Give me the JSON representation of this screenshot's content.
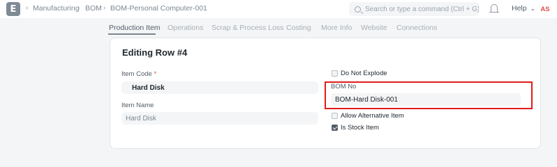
{
  "navbar": {
    "logo_letter": "E",
    "breadcrumbs": [
      "Manufacturing",
      "BOM",
      "BOM-Personal Computer-001"
    ],
    "search_placeholder": "Search or type a command (Ctrl + G)",
    "help_label": "Help",
    "help_chevron": "⌄",
    "avatar_initials": "AS",
    "breadcrumb_separator": "›"
  },
  "tabs": [
    "Production Item",
    "Operations",
    "Scrap & Process Loss",
    "Costing",
    "More Info",
    "Website",
    "Connections"
  ],
  "active_tab": "Production Item",
  "card": {
    "title": "Editing Row #4",
    "item_code": {
      "label": "Item Code",
      "required_mark": "*",
      "value": "Hard Disk"
    },
    "item_name": {
      "label": "Item Name",
      "value": "Hard Disk"
    },
    "do_not_explode": {
      "label": "Do Not Explode",
      "checked": false
    },
    "bom_no": {
      "label": "BOM No",
      "value": "BOM-Hard Disk-001"
    },
    "allow_alternative_item": {
      "label": "Allow Alternative Item",
      "checked": false
    },
    "is_stock_item": {
      "label": "Is Stock Item",
      "checked": true
    }
  },
  "colors": {
    "highlight": "#e21b1b",
    "required": "#e24c4c",
    "avatar_text": "#e24c4c"
  }
}
